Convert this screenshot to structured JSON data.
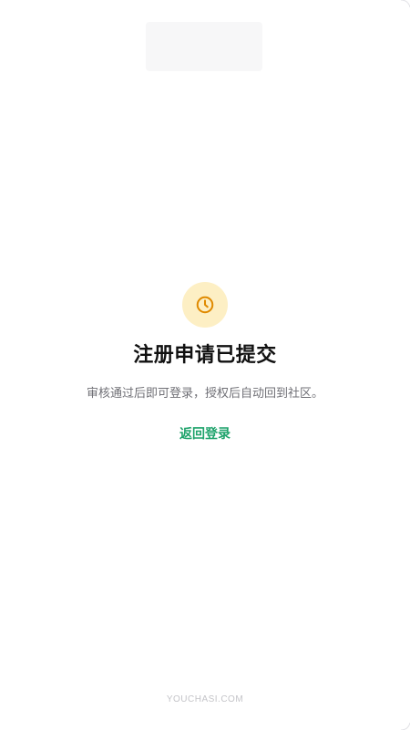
{
  "status": {
    "icon": "clock-icon",
    "icon_color": "#e08a00",
    "icon_bg": "#fdefc4",
    "title": "注册申请已提交",
    "description": "审核通过后即可登录，授权后自动回到社区。"
  },
  "actions": {
    "back_to_login": "返回登录",
    "link_color": "#1ea36b"
  },
  "footer": {
    "brand": "YOUCHASI.COM"
  }
}
